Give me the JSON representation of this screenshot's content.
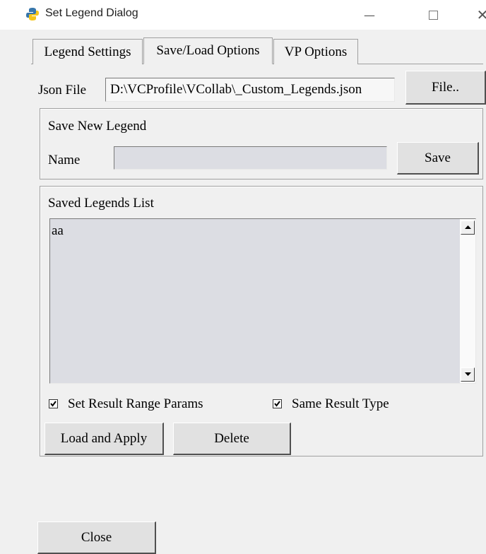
{
  "window": {
    "title": "Set Legend Dialog",
    "minimize_glyph": "—",
    "close_glyph": "✕"
  },
  "tabs": [
    {
      "label": "Legend Settings",
      "active": false
    },
    {
      "label": "Save/Load Options",
      "active": true
    },
    {
      "label": "VP Options",
      "active": false
    }
  ],
  "json_file": {
    "label": "Json File",
    "value": "D:\\VCProfile\\VCollab\\_Custom_Legends.json",
    "button": "File.."
  },
  "save_group": {
    "title": "Save New Legend",
    "name_label": "Name",
    "name_value": "",
    "save_button": "Save"
  },
  "saved_list": {
    "title": "Saved Legends List",
    "items": [
      "aa"
    ],
    "checkboxes": [
      {
        "label": "Set Result Range Params",
        "checked": true
      },
      {
        "label": "Same Result Type",
        "checked": true
      }
    ],
    "load_button": "Load and Apply",
    "delete_button": "Delete"
  },
  "close_button": "Close",
  "icons": {
    "app": "python-icon",
    "scroll_up": "scroll-up-arrow-icon",
    "scroll_down": "scroll-down-arrow-icon",
    "check": "checkmark-icon"
  }
}
